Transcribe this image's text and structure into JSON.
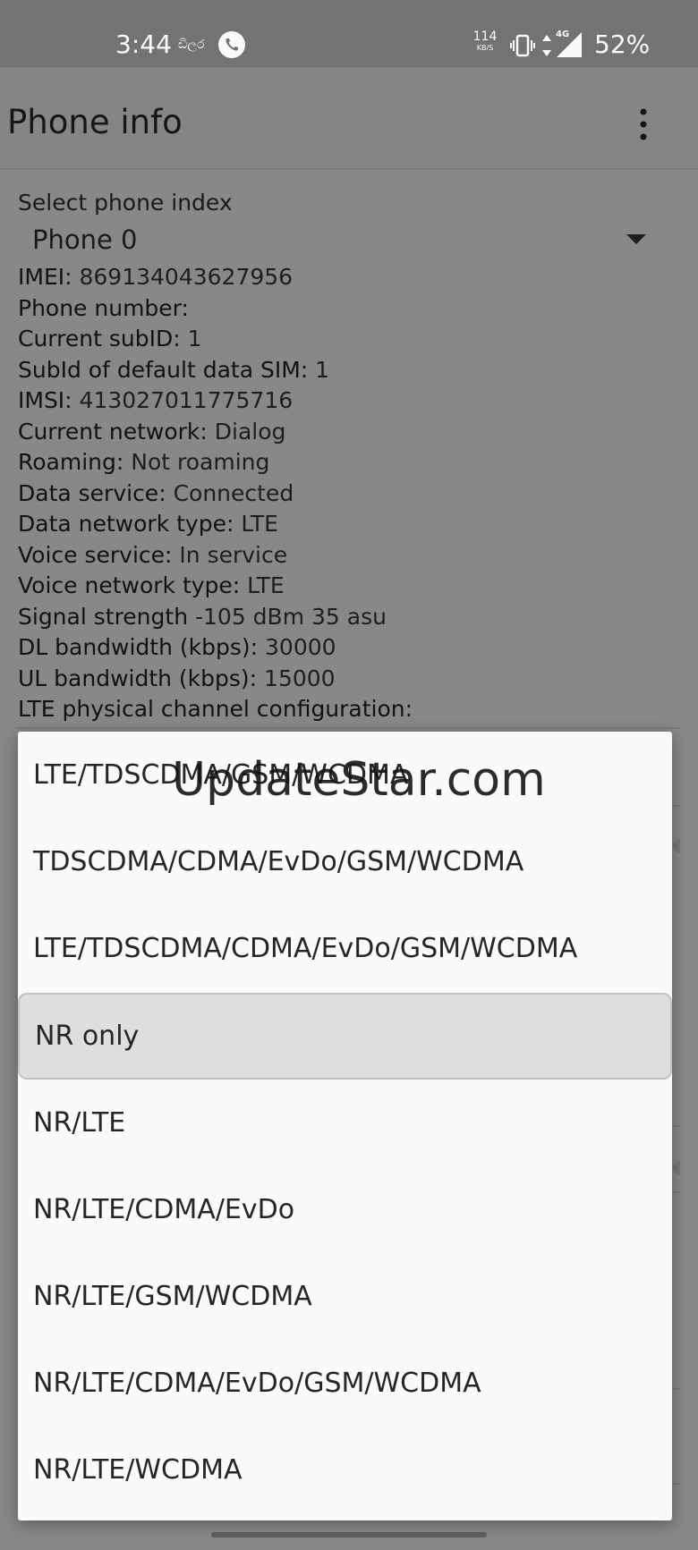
{
  "status_bar": {
    "time": "3:44",
    "carrier": "ඩිලර",
    "net_speed_value": "114",
    "net_speed_unit": "KB/S",
    "network_badge": "4G",
    "battery": "52%"
  },
  "app_bar": {
    "title": "Phone info"
  },
  "phone_select": {
    "label": "Select phone index",
    "value": "Phone 0"
  },
  "info": [
    {
      "label": "IMEI:",
      "value": " 869134043627956"
    },
    {
      "label": "Phone number:",
      "value": ""
    },
    {
      "label": "Current subID:",
      "value": " 1"
    },
    {
      "label": "SubId of default data SIM:",
      "value": " 1"
    },
    {
      "label": "IMSI:",
      "value": " 413027011775716"
    },
    {
      "label": "Current network:",
      "value": " Dialog"
    },
    {
      "label": "Roaming:",
      "value": " Not roaming"
    },
    {
      "label": "Data service:",
      "value": " Connected"
    },
    {
      "label": "Data network type:",
      "value": " LTE"
    },
    {
      "label": "Voice service:",
      "value": " In service"
    },
    {
      "label": "Voice network type:",
      "value": " LTE"
    },
    {
      "label": "Signal strength",
      "value": " -105 dBm   35 asu"
    },
    {
      "label": "DL bandwidth (kbps):",
      "value": " 30000"
    },
    {
      "label": "UL bandwidth (kbps):",
      "value": " 15000"
    },
    {
      "label": "LTE physical channel configuration:",
      "value": ""
    }
  ],
  "dropdown": {
    "items": [
      {
        "label": "LTE/TDSCDMA/GSM/WCDMA",
        "selected": false
      },
      {
        "label": "TDSCDMA/CDMA/EvDo/GSM/WCDMA",
        "selected": false
      },
      {
        "label": "LTE/TDSCDMA/CDMA/EvDo/GSM/WCDMA",
        "selected": false
      },
      {
        "label": "NR only",
        "selected": true
      },
      {
        "label": "NR/LTE",
        "selected": false
      },
      {
        "label": "NR/LTE/CDMA/EvDo",
        "selected": false
      },
      {
        "label": "NR/LTE/GSM/WCDMA",
        "selected": false
      },
      {
        "label": "NR/LTE/CDMA/EvDo/GSM/WCDMA",
        "selected": false
      },
      {
        "label": "NR/LTE/WCDMA",
        "selected": false
      }
    ]
  },
  "watermark": "UpdateStar.com",
  "icons": {
    "call": "phone-call-icon",
    "vibrate": "vibrate-icon",
    "data_arrows": "data-arrows-icon",
    "signal": "signal-icon",
    "overflow": "overflow-menu-icon",
    "dropdown": "chevron-down-icon"
  }
}
